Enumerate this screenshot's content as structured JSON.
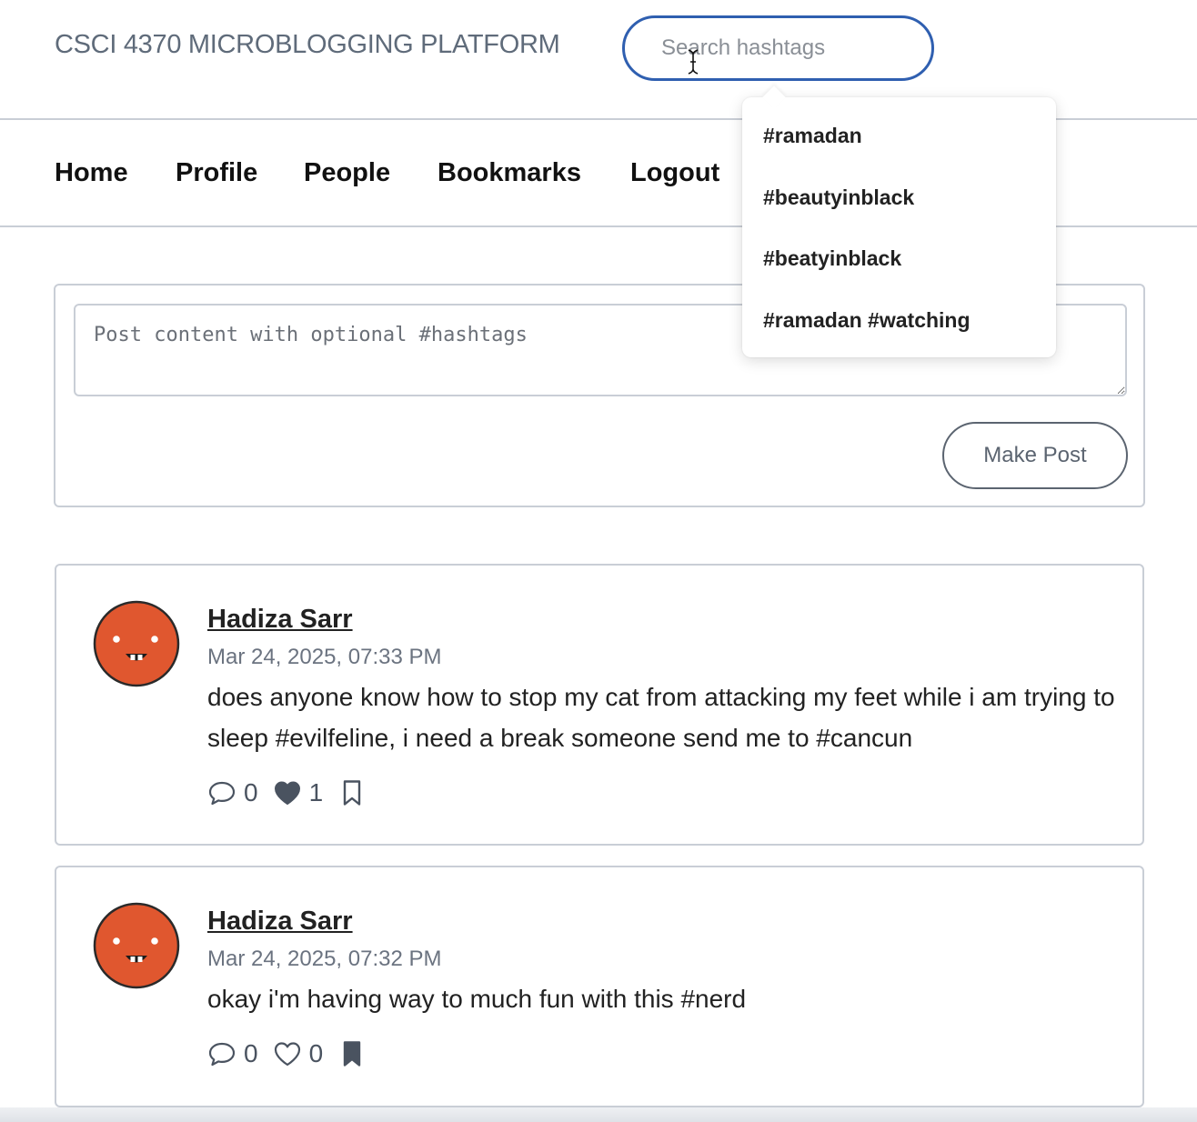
{
  "header": {
    "title": "CSCI 4370 MICROBLOGGING PLATFORM",
    "search_placeholder": "Search hashtags"
  },
  "nav": {
    "items": [
      "Home",
      "Profile",
      "People",
      "Bookmarks",
      "Logout"
    ]
  },
  "search_suggestions": [
    "#ramadan",
    "#beautyinblack",
    "#beatyinblack",
    "#ramadan #watching"
  ],
  "composer": {
    "placeholder": "Post content with optional #hashtags",
    "submit_label": "Make Post"
  },
  "posts": [
    {
      "author": "Hadiza Sarr",
      "timestamp": "Mar 24, 2025, 07:33 PM",
      "content": "does anyone know how to stop my cat from attacking my feet while i am trying to sleep #evilfeline, i need a break someone send me to #cancun",
      "comments": "0",
      "likes": "1",
      "liked": true,
      "bookmarked": false
    },
    {
      "author": "Hadiza Sarr",
      "timestamp": "Mar 24, 2025, 07:32 PM",
      "content": "okay i'm having way to much fun with this #nerd",
      "comments": "0",
      "likes": "0",
      "liked": false,
      "bookmarked": true
    }
  ],
  "colors": {
    "search_border": "#2f5fb0",
    "avatar": "#e0572f",
    "border": "#c9ced6"
  }
}
